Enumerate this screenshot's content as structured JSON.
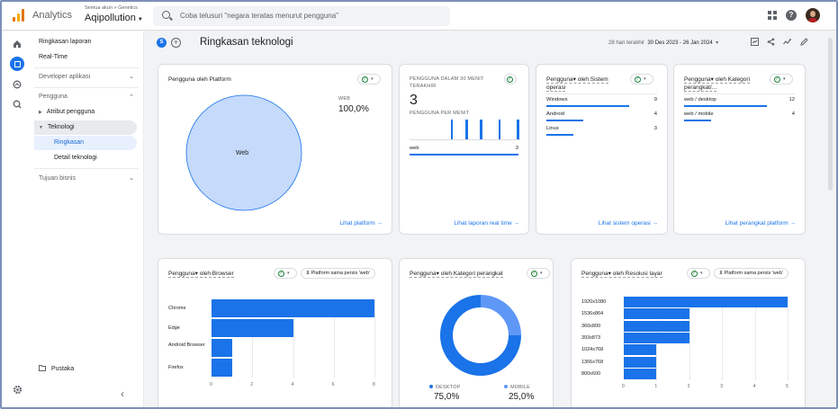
{
  "topbar": {
    "app_name": "Analytics",
    "breadcrumb": "Semua akun > Genetics",
    "property": "Aqipollution",
    "search_placeholder": "Coba telusuri \"negara teratas menurut pengguna\""
  },
  "nav": {
    "items": [
      {
        "label": "Ringkasan laporan"
      },
      {
        "label": "Real-Time"
      },
      {
        "label": "Developer aplikasi"
      },
      {
        "label": "Pengguna"
      },
      {
        "label": "Atribut pengguna"
      },
      {
        "label": "Teknologi"
      },
      {
        "label": "Ringkasan"
      },
      {
        "label": "Detail teknologi"
      },
      {
        "label": "Tujuan bisnis"
      }
    ],
    "library": "Pustaka",
    "collapse": "‹"
  },
  "page": {
    "badge": "S",
    "title": "Ringkasan teknologi",
    "range_prefix": "28 hari terakhir",
    "range": "30 Des 2023 - 26 Jan 2024"
  },
  "platform_card": {
    "title": "Pengguna oleh Platform",
    "legend_label": "WEB",
    "legend_value": "100,0%",
    "pie_label": "Web",
    "link": "Lihat platform →"
  },
  "realtime_card": {
    "title": "PENGGUNA DALAM 30 MENIT TERAKHIR",
    "value": "3",
    "per_minute_label": "PENGGUNA PER MENIT",
    "row_label": "web",
    "row_value": "3",
    "bar_heights": [
      0,
      0,
      0,
      0,
      0,
      0,
      0,
      0,
      0,
      0,
      0,
      1,
      0,
      0,
      0,
      1,
      0,
      0,
      0,
      1,
      0,
      0,
      0,
      0,
      1,
      0,
      0,
      0,
      0,
      1
    ],
    "link": "Lihat laporan real time →"
  },
  "os_card": {
    "title": "Pengguna▾ oleh Sistem operasi",
    "rows": [
      {
        "label": "Windows",
        "value": "9",
        "frac": 1.0
      },
      {
        "label": "Android",
        "value": "4",
        "frac": 0.44
      },
      {
        "label": "Linux",
        "value": "3",
        "frac": 0.33
      }
    ],
    "link": "Lihat sistem operasi →"
  },
  "platform_cat_card": {
    "title": "Pengguna▾ oleh Kategori perangkat/...",
    "rows": [
      {
        "label": "web / desktop",
        "value": "12",
        "frac": 1.0
      },
      {
        "label": "web / mobile",
        "value": "4",
        "frac": 0.33
      }
    ],
    "link": "Lihat perangkat platform →"
  },
  "browser_card": {
    "title": "Pengguna▾ oleh Browser",
    "filter": "Platform sama persis 'web'"
  },
  "device_card": {
    "title": "Pengguna▾ oleh Kategori perangkat",
    "legend": [
      {
        "label": "DESKTOP",
        "value": "75,0%",
        "color": "#1a73e8"
      },
      {
        "label": "MOBILE",
        "value": "25,0%",
        "color": "#5e97f6"
      }
    ]
  },
  "resolution_card": {
    "title": "Pengguna▾ oleh Resolusi layar",
    "filter": "Platform sama persis 'web'"
  },
  "chart_data": [
    {
      "type": "pie",
      "title": "Pengguna oleh Platform",
      "categories": [
        "Web"
      ],
      "values": [
        100.0
      ]
    },
    {
      "type": "bar",
      "title": "Pengguna oleh Browser",
      "orientation": "horizontal",
      "categories": [
        "Chrome",
        "Edge",
        "Android Browser",
        "Firefox"
      ],
      "values": [
        8,
        4,
        1,
        1
      ],
      "xlim": [
        0,
        8
      ],
      "xticks": [
        "0",
        "2",
        "4",
        "6",
        "8"
      ]
    },
    {
      "type": "pie",
      "title": "Pengguna oleh Kategori perangkat",
      "categories": [
        "DESKTOP",
        "MOBILE"
      ],
      "values": [
        75.0,
        25.0
      ]
    },
    {
      "type": "bar",
      "title": "Pengguna oleh Resolusi layar",
      "orientation": "horizontal",
      "categories": [
        "1920x1080",
        "1536x864",
        "360x800",
        "393x873",
        "1024x768",
        "1366x768",
        "800x600"
      ],
      "values": [
        5,
        2,
        2,
        2,
        1,
        1,
        1
      ],
      "xlim": [
        0,
        5
      ],
      "xticks": [
        "0",
        "1",
        "2",
        "3",
        "4",
        "5"
      ]
    }
  ]
}
